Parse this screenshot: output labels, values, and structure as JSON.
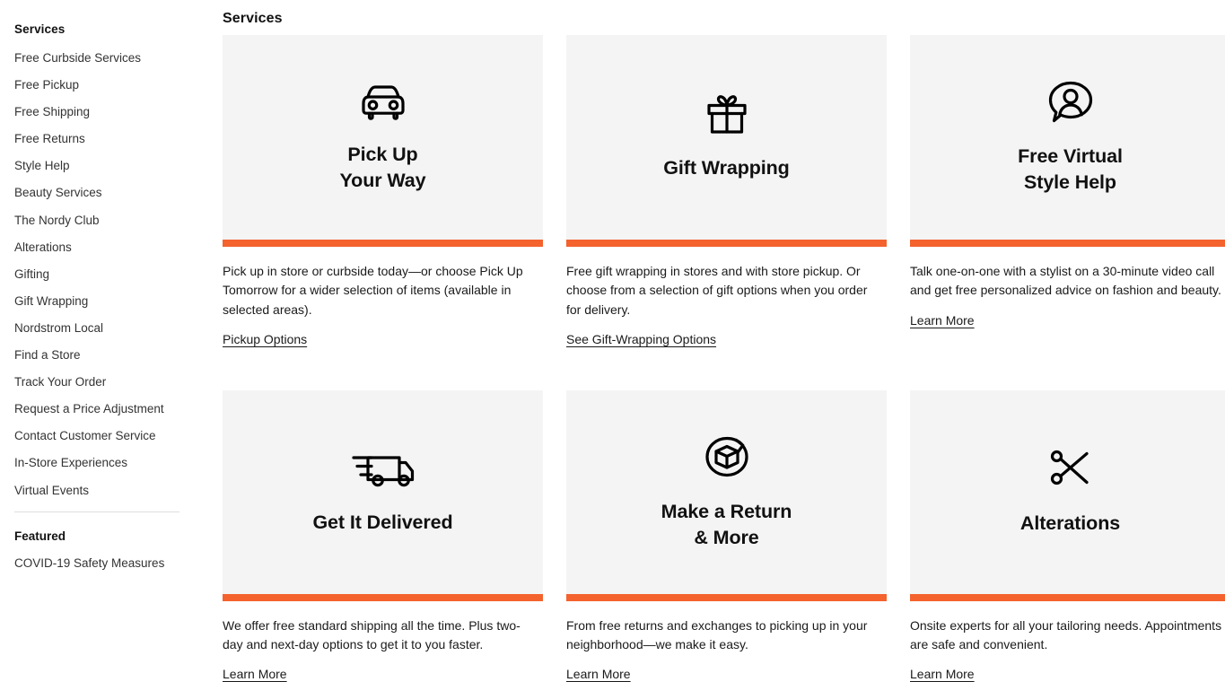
{
  "sidebar": {
    "heading": "Services",
    "items": [
      {
        "label": "Free Curbside Services"
      },
      {
        "label": "Free Pickup"
      },
      {
        "label": "Free Shipping"
      },
      {
        "label": "Free Returns"
      },
      {
        "label": "Style Help"
      },
      {
        "label": "Beauty Services"
      },
      {
        "label": "The Nordy Club"
      },
      {
        "label": "Alterations"
      },
      {
        "label": "Gifting"
      },
      {
        "label": "Gift Wrapping"
      },
      {
        "label": "Nordstrom Local"
      },
      {
        "label": "Find a Store"
      },
      {
        "label": "Track Your Order"
      },
      {
        "label": "Request a Price Adjustment"
      },
      {
        "label": "Contact Customer Service"
      },
      {
        "label": "In-Store Experiences"
      },
      {
        "label": "Virtual Events"
      }
    ],
    "featured_heading": "Featured",
    "featured_items": [
      {
        "label": "COVID-19 Safety Measures"
      }
    ]
  },
  "main": {
    "title": "Services",
    "accent_color": "#f4622d",
    "tile_background": "#f4f4f4",
    "cards": [
      {
        "icon": "car-front-icon",
        "title": "Pick Up\nYour Way",
        "title_line1": "Pick Up",
        "title_line2": "Your Way",
        "description": "Pick up in store or curbside today—or choose Pick Up Tomorrow for a wider selection of items (available in selected areas).",
        "link_label": "Pickup Options"
      },
      {
        "icon": "gift-box-icon",
        "title": "Gift Wrapping",
        "title_line1": "Gift Wrapping",
        "title_line2": "",
        "description": "Free gift wrapping in stores and with store pickup. Or choose from a selection of gift options when you order for delivery.",
        "link_label": "See Gift-Wrapping Options"
      },
      {
        "icon": "person-speech-bubble-icon",
        "title": "Free Virtual\nStyle Help",
        "title_line1": "Free Virtual",
        "title_line2": "Style Help",
        "description": "Talk one-on-one with a stylist on a 30-minute video call and get free personalized advice on fashion and beauty.",
        "link_label": "Learn More"
      },
      {
        "icon": "delivery-truck-icon",
        "title": "Get It Delivered",
        "title_line1": "Get It Delivered",
        "title_line2": "",
        "description": "We offer free standard shipping all the time. Plus two-day and next-day options to get it to you faster.",
        "link_label": "Learn More"
      },
      {
        "icon": "box-return-arrow-icon",
        "title": "Make a Return\n& More",
        "title_line1": "Make a Return",
        "title_line2": "& More",
        "description": "From free returns and exchanges to picking up in your neighborhood—we make it easy.",
        "link_label": "Learn More"
      },
      {
        "icon": "scissors-icon",
        "title": "Alterations",
        "title_line1": "Alterations",
        "title_line2": "",
        "description": "Onsite experts for all your tailoring needs. Appointments are safe and convenient.",
        "link_label": "Learn More"
      }
    ]
  }
}
